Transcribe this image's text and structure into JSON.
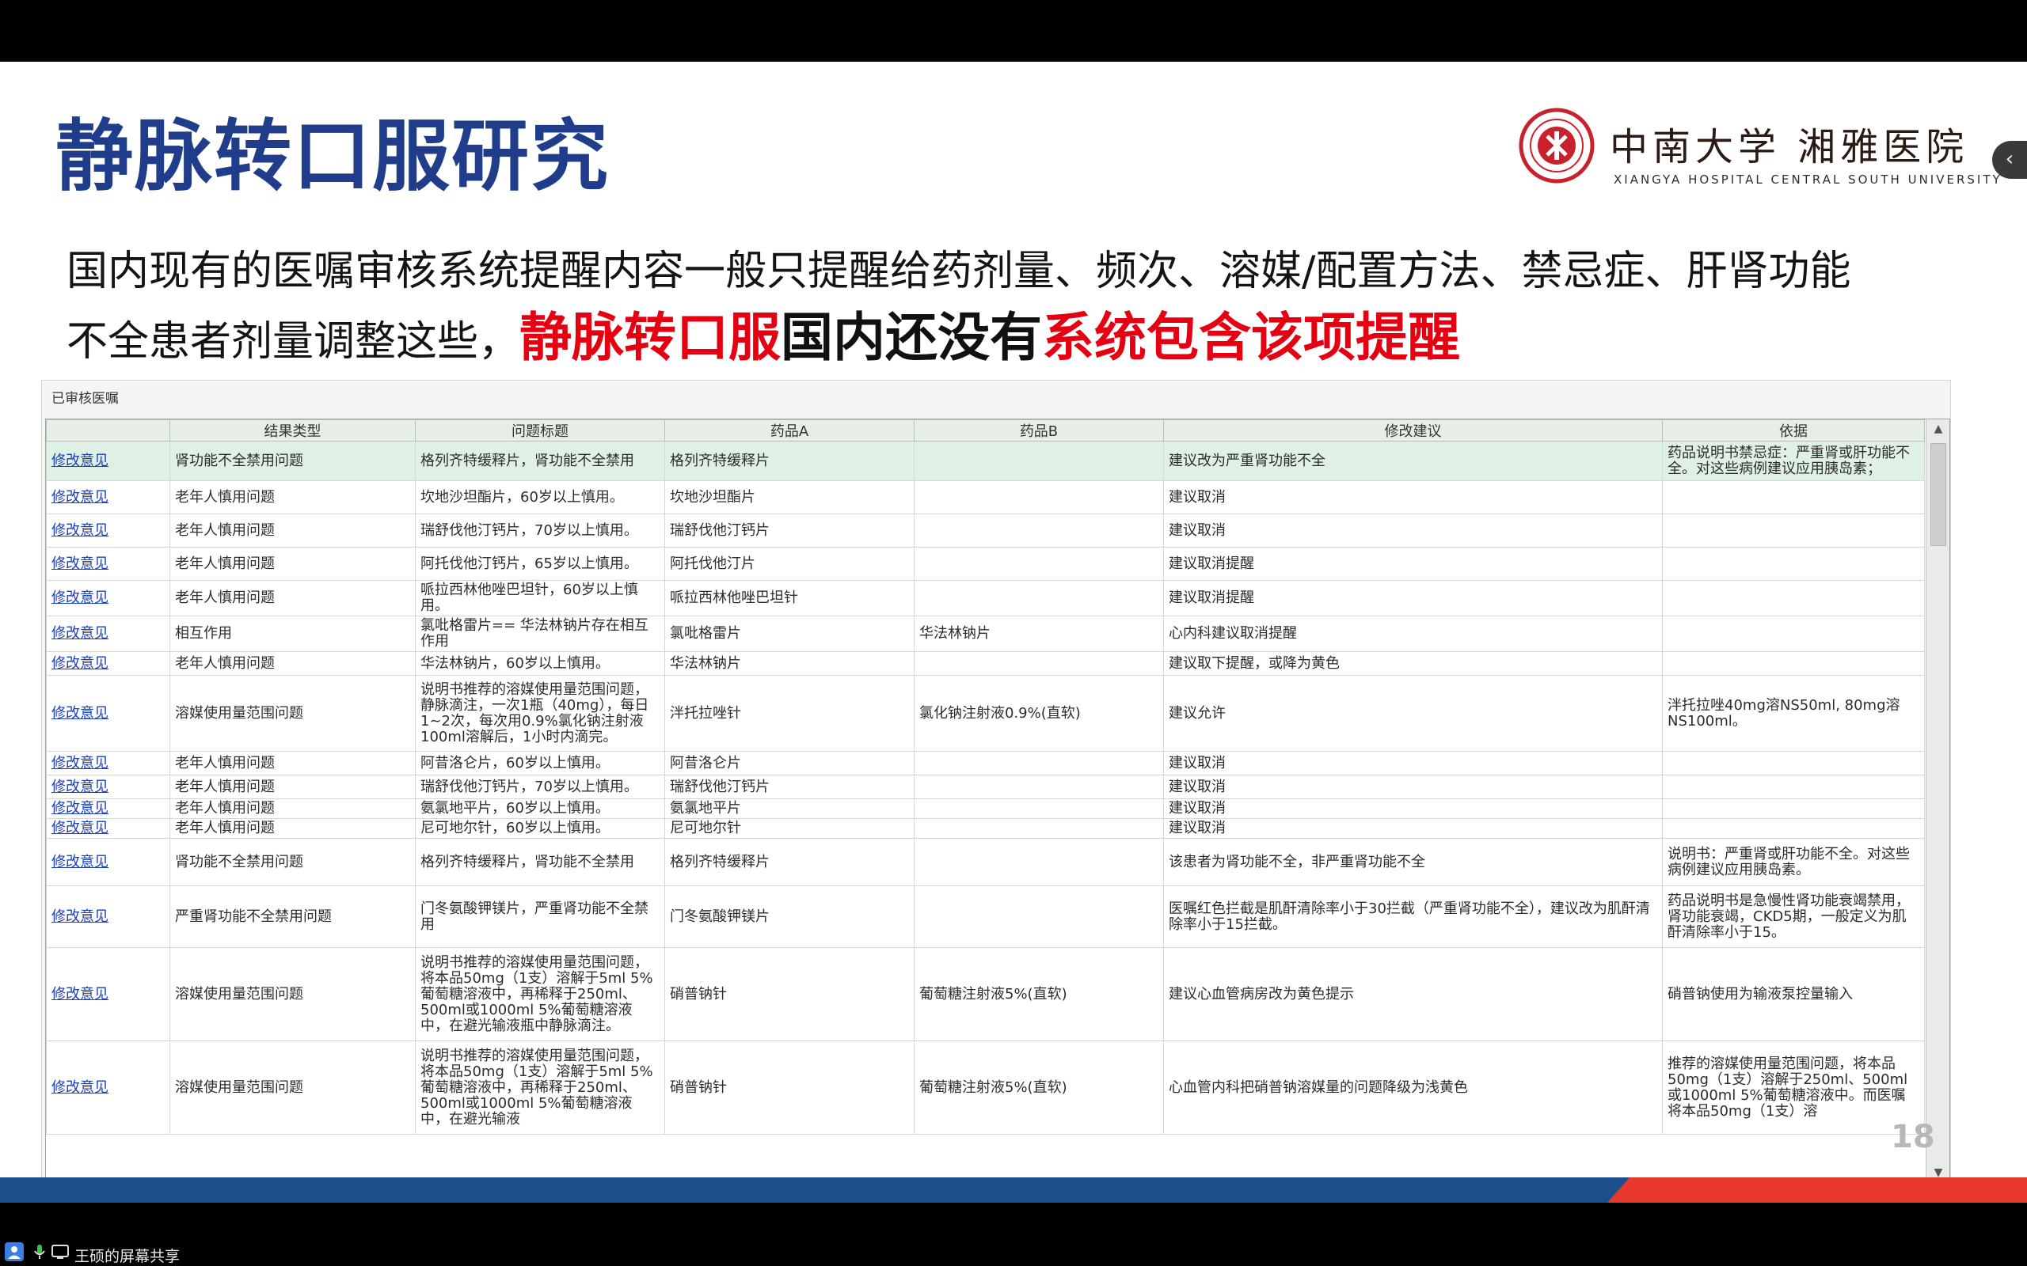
{
  "slide": {
    "title": "静脉转口服研究",
    "body_line1": "国内现有的医嘱审核系统提醒内容一般只提醒给药剂量、频次、溶媒/配置方法、禁忌症、肝肾功能",
    "body_line2_plain": "不全患者剂量调整这些，",
    "body_line2_red1": "静脉转口服",
    "body_line2_black": "国内还没有",
    "body_line2_red2": "系统包含该项提醒",
    "logo_cn": "中南大学 湘雅医院",
    "logo_en": "XIANGYA HOSPITAL CENTRAL SOUTH UNIVERSITY",
    "page_number": "18"
  },
  "table_panel": {
    "title": "已审核医嘱",
    "columns": [
      "",
      "结果类型",
      "问题标题",
      "药品A",
      "药品B",
      "修改建议",
      "依据"
    ],
    "rows": [
      {
        "action": "修改意见",
        "type": "肾功能不全禁用问题",
        "issue": "格列齐特缓释片，肾功能不全禁用",
        "drug_a": "格列齐特缓释片",
        "drug_b": "",
        "suggestion": "建议改为严重肾功能不全",
        "basis": "药品说明书禁忌症：严重肾或肝功能不全。对这些病例建议应用胰岛素；"
      },
      {
        "action": "修改意见",
        "type": "老年人慎用问题",
        "issue": "坎地沙坦酯片，60岁以上慎用。",
        "drug_a": "坎地沙坦酯片",
        "drug_b": "",
        "suggestion": "建议取消",
        "basis": ""
      },
      {
        "action": "修改意见",
        "type": "老年人慎用问题",
        "issue": "瑞舒伐他汀钙片，70岁以上慎用。",
        "drug_a": "瑞舒伐他汀钙片",
        "drug_b": "",
        "suggestion": "建议取消",
        "basis": ""
      },
      {
        "action": "修改意见",
        "type": "老年人慎用问题",
        "issue": "阿托伐他汀钙片，65岁以上慎用。",
        "drug_a": "阿托伐他汀片",
        "drug_b": "",
        "suggestion": "建议取消提醒",
        "basis": ""
      },
      {
        "action": "修改意见",
        "type": "老年人慎用问题",
        "issue": "哌拉西林他唑巴坦针，60岁以上慎用。",
        "drug_a": "哌拉西林他唑巴坦针",
        "drug_b": "",
        "suggestion": "建议取消提醒",
        "basis": ""
      },
      {
        "action": "修改意见",
        "type": "相互作用",
        "issue": "氯吡格雷片== 华法林钠片存在相互作用",
        "drug_a": "氯吡格雷片",
        "drug_b": "华法林钠片",
        "suggestion": "心内科建议取消提醒",
        "basis": ""
      },
      {
        "action": "修改意见",
        "type": "老年人慎用问题",
        "issue": "华法林钠片，60岁以上慎用。",
        "drug_a": "华法林钠片",
        "drug_b": "",
        "suggestion": "建议取下提醒，或降为黄色",
        "basis": ""
      },
      {
        "action": "修改意见",
        "type": "溶媒使用量范围问题",
        "issue": "说明书推荐的溶媒使用量范围问题，静脉滴注，一次1瓶（40mg），每日1~2次，每次用0.9%氯化钠注射液100ml溶解后，1小时内滴完。",
        "drug_a": "泮托拉唑针",
        "drug_b": "氯化钠注射液0.9%(直软)",
        "suggestion": "建议允许",
        "basis": "泮托拉唑40mg溶NS50ml, 80mg溶NS100ml。"
      },
      {
        "action": "修改意见",
        "type": "老年人慎用问题",
        "issue": "阿昔洛仑片，60岁以上慎用。",
        "drug_a": "阿昔洛仑片",
        "drug_b": "",
        "suggestion": "建议取消",
        "basis": ""
      },
      {
        "action": "修改意见",
        "type": "老年人慎用问题",
        "issue": "瑞舒伐他汀钙片，70岁以上慎用。",
        "drug_a": "瑞舒伐他汀钙片",
        "drug_b": "",
        "suggestion": "建议取消",
        "basis": ""
      },
      {
        "action": "修改意见",
        "type": "老年人慎用问题",
        "issue": "氨氯地平片，60岁以上慎用。",
        "drug_a": "氨氯地平片",
        "drug_b": "",
        "suggestion": "建议取消",
        "basis": ""
      },
      {
        "action": "修改意见",
        "type": "老年人慎用问题",
        "issue": "尼可地尔针，60岁以上慎用。",
        "drug_a": "尼可地尔针",
        "drug_b": "",
        "suggestion": "建议取消",
        "basis": ""
      },
      {
        "action": "修改意见",
        "type": "肾功能不全禁用问题",
        "issue": "格列齐特缓释片，肾功能不全禁用",
        "drug_a": "格列齐特缓释片",
        "drug_b": "",
        "suggestion": "该患者为肾功能不全，非严重肾功能不全",
        "basis": "说明书：严重肾或肝功能不全。对这些病例建议应用胰岛素。"
      },
      {
        "action": "修改意见",
        "type": "严重肾功能不全禁用问题",
        "issue": "门冬氨酸钾镁片，严重肾功能不全禁用",
        "drug_a": "门冬氨酸钾镁片",
        "drug_b": "",
        "suggestion": "医嘱红色拦截是肌酐清除率小于30拦截（严重肾功能不全），建议改为肌酐清除率小于15拦截。",
        "basis": "药品说明书是急慢性肾功能衰竭禁用，肾功能衰竭，CKD5期，一般定义为肌酐清除率小于15。"
      },
      {
        "action": "修改意见",
        "type": "溶媒使用量范围问题",
        "issue": "说明书推荐的溶媒使用量范围问题，将本品50mg（1支）溶解于5ml 5%葡萄糖溶液中，再稀释于250ml、500ml或1000ml 5%葡萄糖溶液中，在避光输液瓶中静脉滴注。",
        "drug_a": "硝普钠针",
        "drug_b": "葡萄糖注射液5%(直软)",
        "suggestion": "建议心血管病房改为黄色提示",
        "basis": "硝普钠使用为输液泵控量输入"
      },
      {
        "action": "修改意见",
        "type": "溶媒使用量范围问题",
        "issue": "说明书推荐的溶媒使用量范围问题，将本品50mg（1支）溶解于5ml 5%葡萄糖溶液中，再稀释于250ml、500ml或1000ml 5%葡萄糖溶液中，在避光输液",
        "drug_a": "硝普钠针",
        "drug_b": "葡萄糖注射液5%(直软)",
        "suggestion": "心血管内科把硝普钠溶媒量的问题降级为浅黄色",
        "basis": "推荐的溶媒使用量范围问题，将本品50mg（1支）溶解于250ml、500ml或1000ml 5%葡萄糖溶液中。而医嘱将本品50mg（1支）溶"
      }
    ]
  },
  "taskbar": {
    "share_label": "王硕的屏幕共享"
  },
  "colors": {
    "title_blue": "#1f3d8a",
    "highlight_red": "#e50012",
    "footer_blue": "#1d4f8c",
    "footer_red": "#e6392c",
    "row_highlight": "#dff0e4",
    "link_blue": "#1a3fbf"
  },
  "icons": [
    "xiangya-seal-icon",
    "person-icon",
    "microphone-icon",
    "screen-share-icon",
    "chevron-left-icon",
    "scroll-up-arrow-icon",
    "scroll-down-arrow-icon"
  ]
}
